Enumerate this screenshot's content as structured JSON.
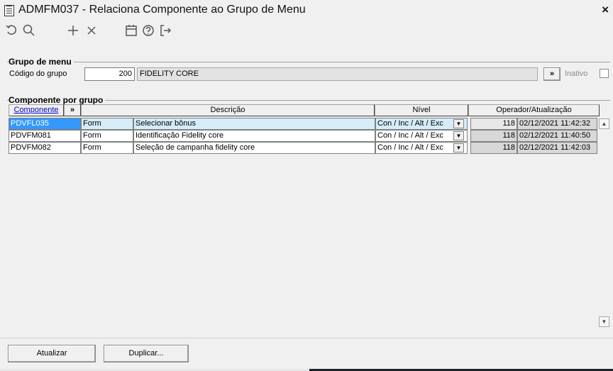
{
  "window": {
    "title": "ADMFM037 - Relaciona Componente ao Grupo de Menu",
    "close_label": "×"
  },
  "toolbar": {
    "icons": [
      "undo-icon",
      "search-icon",
      "add-icon",
      "delete-icon",
      "calendar-icon",
      "help-icon",
      "exit-icon"
    ]
  },
  "grupo_menu": {
    "title": "Grupo de menu",
    "codigo_label": "Código do grupo",
    "codigo_value": "200",
    "descricao_value": "FIDELITY CORE",
    "lookup_label": "»",
    "inativo_label": "Inativo"
  },
  "componente_grupo": {
    "title": "Componente por grupo",
    "columns": {
      "componente": "Componente",
      "expand": "»",
      "descricao": "Descrição",
      "nivel": "Nível",
      "operador": "Operador/Atualização"
    },
    "rows": [
      {
        "componente": "PDVFL035",
        "tipo": "Form",
        "descricao": "Selecionar bônus",
        "nivel": "Con / Inc / Alt / Exc",
        "operador": "118",
        "atualizacao": "02/12/2021 11:42:32"
      },
      {
        "componente": "PDVFM081",
        "tipo": "Form",
        "descricao": "Identificação Fidelity core",
        "nivel": "Con / Inc / Alt / Exc",
        "operador": "118",
        "atualizacao": "02/12/2021 11:40:50"
      },
      {
        "componente": "PDVFM082",
        "tipo": "Form",
        "descricao": "Seleção de campanha fidelity core",
        "nivel": "Con / Inc / Alt / Exc",
        "operador": "118",
        "atualizacao": "02/12/2021 11:42:03"
      }
    ]
  },
  "footer": {
    "atualizar_label": "Atualizar",
    "duplicar_label": "Duplicar..."
  },
  "colors": {
    "selection": "#3399ff",
    "row_highlight": "#d6ecf8",
    "readonly_cell": "#d8d8d8"
  }
}
